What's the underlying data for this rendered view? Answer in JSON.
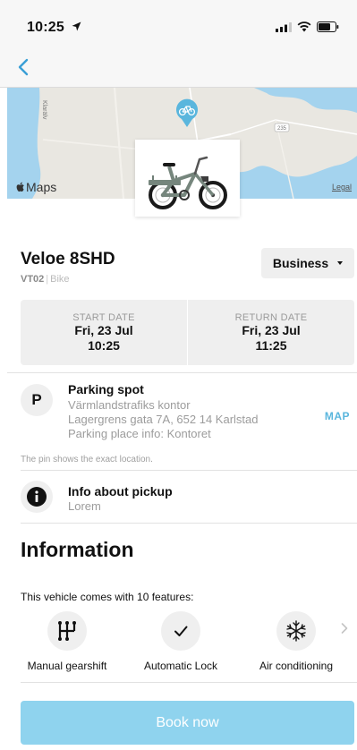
{
  "status_bar": {
    "time": "10:25"
  },
  "map": {
    "maps_label": "Maps",
    "legal_label": "Legal",
    "street_label": "Klarälv",
    "marker_label": "235"
  },
  "vehicle": {
    "name": "Veloe 8SHD",
    "code": "VT02",
    "separator": "|",
    "type": "Bike",
    "plan_label": "Business"
  },
  "dates": {
    "start": {
      "label": "START DATE",
      "date": "Fri, 23 Jul",
      "time": "10:25"
    },
    "return": {
      "label": "RETURN DATE",
      "date": "Fri, 23 Jul",
      "time": "11:25"
    }
  },
  "parking": {
    "icon_letter": "P",
    "title": "Parking spot",
    "lines": [
      "Värmlandstrafiks kontor",
      "Lagergrens gata 7A, 652 14 Karlstad",
      "Parking place info: Kontoret"
    ],
    "map_link": "MAP",
    "note": "The pin shows the exact location."
  },
  "pickup": {
    "title": "Info about pickup",
    "subtitle": "Lorem"
  },
  "information": {
    "heading": "Information",
    "features_intro": "This vehicle comes with 10 features:",
    "features": [
      {
        "label": "Manual gearshift",
        "icon": "gearshift-icon"
      },
      {
        "label": "Automatic Lock",
        "icon": "checkmark-icon"
      },
      {
        "label": "Air conditioning",
        "icon": "snowflake-icon"
      }
    ]
  },
  "book_button": {
    "label": "Book now"
  },
  "colors": {
    "accent": "#5ab6dd",
    "book_button": "#8fd3ee",
    "water": "#a4d3ee",
    "land": "#e9e7e1"
  }
}
